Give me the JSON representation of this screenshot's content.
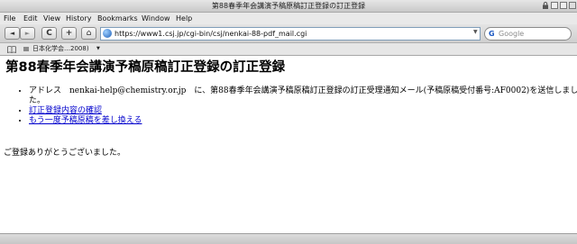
{
  "window": {
    "title": "第88春季年会講演予稿原稿訂正登録の訂正登録"
  },
  "menu": {
    "items": [
      "File",
      "Edit",
      "View",
      "History",
      "Bookmarks",
      "Window",
      "Help"
    ]
  },
  "toolbar": {
    "back_glyph": "◄",
    "forward_glyph": "►",
    "reload_glyph": "C",
    "new_tab_glyph": "+",
    "home_glyph": "⌂",
    "url": "https://www1.csj.jp/cgi-bin/csj/nenkai-88-pdf_mail.cgi",
    "search_placeholder": "Google",
    "search_engine_glyph": "G"
  },
  "bookmarks": {
    "item_label": "日本化学会…2008)"
  },
  "page": {
    "heading": "第88春季年会講演予稿原稿訂正登録の訂正登録",
    "notice": "アドレス　nenkai-help@chemistry.or.jp　に、第88春季年会講演予稿原稿訂正登録の訂正受理通知メール(予稿原稿受付番号:AF0002)を送信しました。",
    "links": [
      "訂正登録内容の確認",
      "もう一度予稿原稿を差し換える"
    ],
    "thanks": "ご登録ありがとうございました。"
  },
  "colors": {
    "link": "#0000cc",
    "url_border": "#7f9db9"
  }
}
